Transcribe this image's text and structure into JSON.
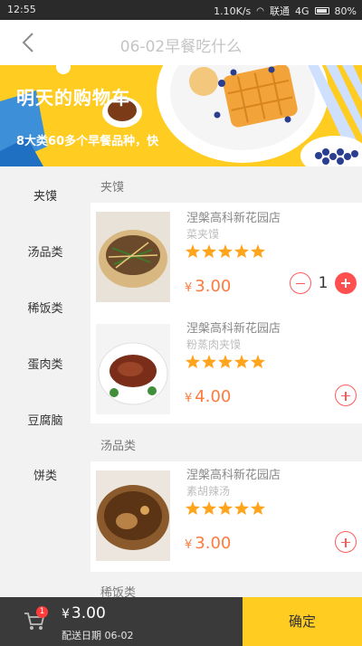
{
  "status_bar": {
    "time": "12:55",
    "speed": "1.10K/s",
    "carrier": "联通",
    "network": "4G",
    "battery": "80%"
  },
  "header": {
    "title": "06-02早餐吃什么",
    "back_icon": "back-chevron-icon"
  },
  "banner": {
    "title": "明天的购物车",
    "subtitle": "8大类60多个早餐品种，快"
  },
  "categories": [
    {
      "label": "夹馍"
    },
    {
      "label": "汤品类"
    },
    {
      "label": "稀饭类"
    },
    {
      "label": "蛋肉类"
    },
    {
      "label": "豆腐脑"
    },
    {
      "label": "饼类"
    }
  ],
  "sections": [
    {
      "title": "夹馍",
      "items": [
        {
          "shop": "涅槃高科新花园店",
          "name": "菜夹馍",
          "rating": 5,
          "currency": "¥",
          "price": "3.00",
          "quantity": "1"
        },
        {
          "shop": "涅槃高科新花园店",
          "name": "粉蒸肉夹馍",
          "rating": 5,
          "currency": "¥",
          "price": "4.00",
          "quantity": ""
        }
      ]
    },
    {
      "title": "汤品类",
      "items": [
        {
          "shop": "涅槃高科新花园店",
          "name": "素胡辣汤",
          "rating": 5,
          "currency": "¥",
          "price": "3.00",
          "quantity": ""
        }
      ]
    },
    {
      "title": "稀饭类",
      "items": []
    }
  ],
  "cart": {
    "badge": "1",
    "currency": "¥",
    "total": "3.00",
    "delivery": "配送日期 06-02",
    "confirm_label": "确定"
  },
  "colors": {
    "accent": "#ffcc21",
    "price": "#ff7a3c",
    "star": "#ffa41b",
    "button": "#ff4f4f",
    "bottom_bar": "#3a3a3a"
  }
}
